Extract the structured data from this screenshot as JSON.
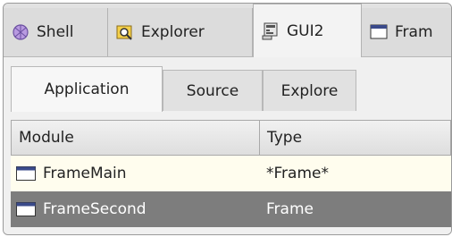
{
  "top_tabs": [
    {
      "label": "Shell",
      "icon": "shell-icon"
    },
    {
      "label": "Explorer",
      "icon": "explorer-icon"
    },
    {
      "label": "GUI2",
      "icon": "gui-icon",
      "active": true
    },
    {
      "label": "Fram",
      "icon": "frame-window-icon"
    }
  ],
  "inner_tabs": [
    {
      "label": "Application",
      "active": true
    },
    {
      "label": "Source"
    },
    {
      "label": "Explore"
    }
  ],
  "table": {
    "columns": [
      "Module",
      "Type"
    ],
    "rows": [
      {
        "module": "FrameMain",
        "type": "*Frame*"
      },
      {
        "module": "FrameSecond",
        "type": "Frame",
        "selected": true
      }
    ]
  },
  "colors": {
    "selected_row": "#7d7d7d",
    "row_highlight": "#fffdee"
  }
}
